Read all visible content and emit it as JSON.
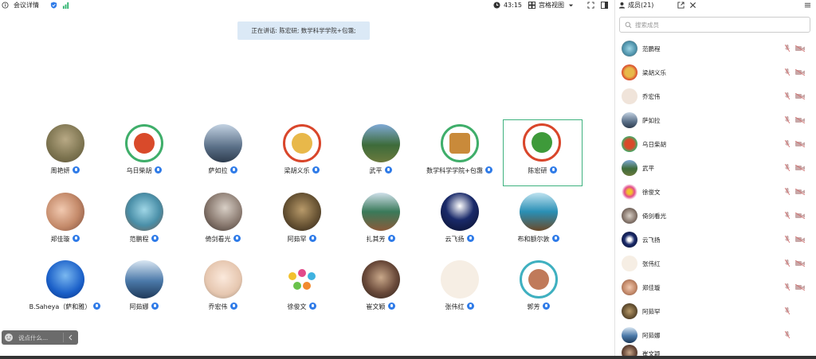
{
  "topbar": {
    "meeting_details": "会议详情",
    "timer": "43:15",
    "grid_view": "宫格视图"
  },
  "speaking_banner": "正在讲话: 陈宏研; 数学科学学院+包霭;",
  "grid": [
    {
      "name": "周艳妍"
    },
    {
      "name": "乌日柴胡"
    },
    {
      "name": "萨如拉"
    },
    {
      "name": "梁胡义乐"
    },
    {
      "name": "武平"
    },
    {
      "name": "数学科学学院+包霭"
    },
    {
      "name": "陈宏研"
    },
    {
      "name": "郑佳璇"
    },
    {
      "name": "范鹏程"
    },
    {
      "name": "倚剑看光"
    },
    {
      "name": "阿茹罕"
    },
    {
      "name": "扎其芳"
    },
    {
      "name": "云飞扬"
    },
    {
      "name": "布和额尔敦"
    },
    {
      "name": "B.Saheya（萨和雅）"
    },
    {
      "name": "阿茹娜"
    },
    {
      "name": "乔宏伟"
    },
    {
      "name": "徐俊文"
    },
    {
      "name": "崔文颖"
    },
    {
      "name": "张伟红"
    },
    {
      "name": "郭芳"
    }
  ],
  "say_placeholder": "说点什么...",
  "members_panel": {
    "title": "成员(21)",
    "search_placeholder": "搜索成员",
    "members": [
      "范鹏程",
      "梁胡义乐",
      "乔宏伟",
      "萨如拉",
      "乌日柴胡",
      "武平",
      "徐俊文",
      "倚剑看光",
      "云飞扬",
      "张伟红",
      "郑佳璇",
      "阿茹罕",
      "阿茹娜",
      "崔文颖"
    ]
  }
}
